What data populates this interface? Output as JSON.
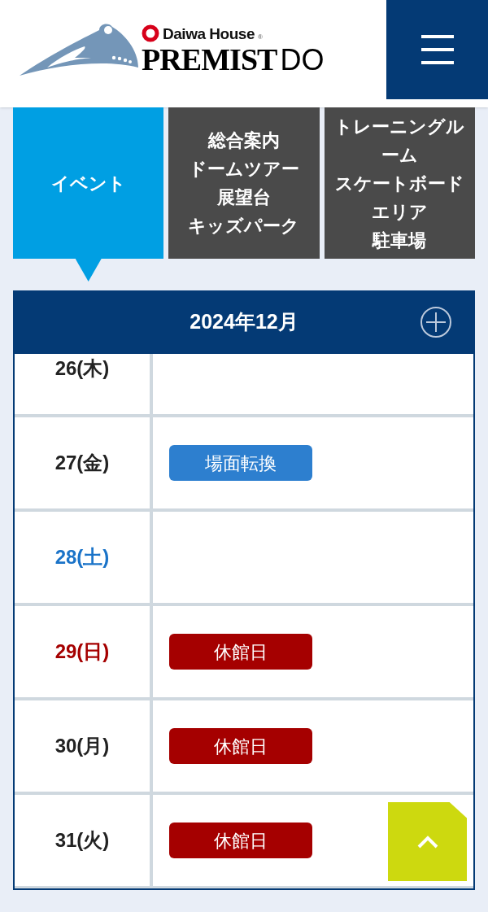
{
  "header": {
    "brand": "Daiwa House",
    "registered": "®",
    "logo_main": "PREMIST",
    "logo_sub": "DO"
  },
  "tabs": [
    {
      "lines": [
        "イベント"
      ],
      "selected": true
    },
    {
      "lines": [
        "総合案内",
        "ドームツアー",
        "展望台",
        "キッズパーク"
      ],
      "selected": false
    },
    {
      "lines": [
        "トレーニングルーム",
        "スケートボードエリア",
        "駐車場"
      ],
      "selected": false
    }
  ],
  "calendar": {
    "title": "2024年12月",
    "days": [
      {
        "date": "26(木)",
        "kind": "weekday"
      },
      {
        "date": "27(金)",
        "kind": "weekday",
        "events": [
          {
            "label": "場面転換",
            "kind": "event"
          }
        ]
      },
      {
        "date": "28(土)",
        "kind": "saturday"
      },
      {
        "date": "29(日)",
        "kind": "sunday",
        "events": [
          {
            "label": "休館日",
            "kind": "closed"
          }
        ]
      },
      {
        "date": "30(月)",
        "kind": "weekday",
        "events": [
          {
            "label": "休館日",
            "kind": "closed"
          }
        ]
      },
      {
        "date": "31(火)",
        "kind": "weekday",
        "events": [
          {
            "label": "休館日",
            "kind": "closed"
          }
        ]
      }
    ]
  }
}
